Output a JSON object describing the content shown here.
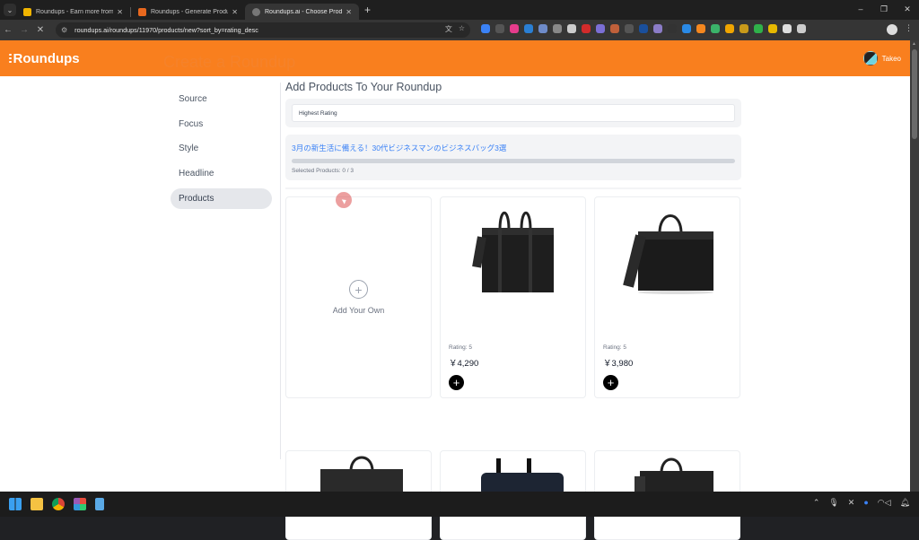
{
  "browser": {
    "tabs": [
      {
        "title": "Roundups - Earn more from yo",
        "favicon_color": "#f0b400",
        "active": false
      },
      {
        "title": "Roundups - Generate Product B",
        "favicon_color": "#e8681e",
        "active": false
      },
      {
        "title": "Roundups.ai - Choose Products",
        "favicon_color": "#888888",
        "active": true
      }
    ],
    "new_tab_label": "+",
    "url": "roundups.ai/roundups/11970/products/new?sort_by=rating_desc",
    "window_controls": {
      "minimize": "–",
      "restore": "❐",
      "close": "✕"
    },
    "extension_colors": [
      "#3b82f6",
      "#555555",
      "#e63c8c",
      "#2a7fd4",
      "#6e8bc9",
      "#888888",
      "#cccccc",
      "#d22b2b",
      "#7b6fd6",
      "#c0603a",
      "#555555",
      "#1a4f9c",
      "#8b7cc7",
      "#333333",
      "#2a8ae6",
      "#f5871f",
      "#3bb36a",
      "#f0a500",
      "#c99a1a",
      "#2fb14a",
      "#e6b800",
      "#dddddd",
      "#cccccc"
    ]
  },
  "app": {
    "logo": "Roundups",
    "user_name": "Takeo",
    "page_title": "Create a Roundup",
    "steps": [
      {
        "label": "Source",
        "active": false
      },
      {
        "label": "Focus",
        "active": false
      },
      {
        "label": "Style",
        "active": false
      },
      {
        "label": "Headline",
        "active": false
      },
      {
        "label": "Products",
        "active": true
      }
    ],
    "section_title": "Add Products To Your Roundup",
    "sort_select_value": "Highest Rating",
    "roundup_headline": "3月の新生活に備える！30代ビジネスマンのビジネスバッグ3選",
    "selected_progress_fraction": 0.0,
    "selected_products_label": "Selected Products: 0 / 3",
    "add_your_own_label": "Add Your Own",
    "products": [
      {
        "rating_label": "Rating: 5",
        "price": "￥4,290",
        "add_icon": "plus-circle-icon"
      },
      {
        "rating_label": "Rating: 5",
        "price": "￥3,980",
        "add_icon": "plus-circle-icon"
      }
    ]
  },
  "colors": {
    "brand": "#f97f1e",
    "title": "#f5822a",
    "link": "#3b82f6"
  }
}
